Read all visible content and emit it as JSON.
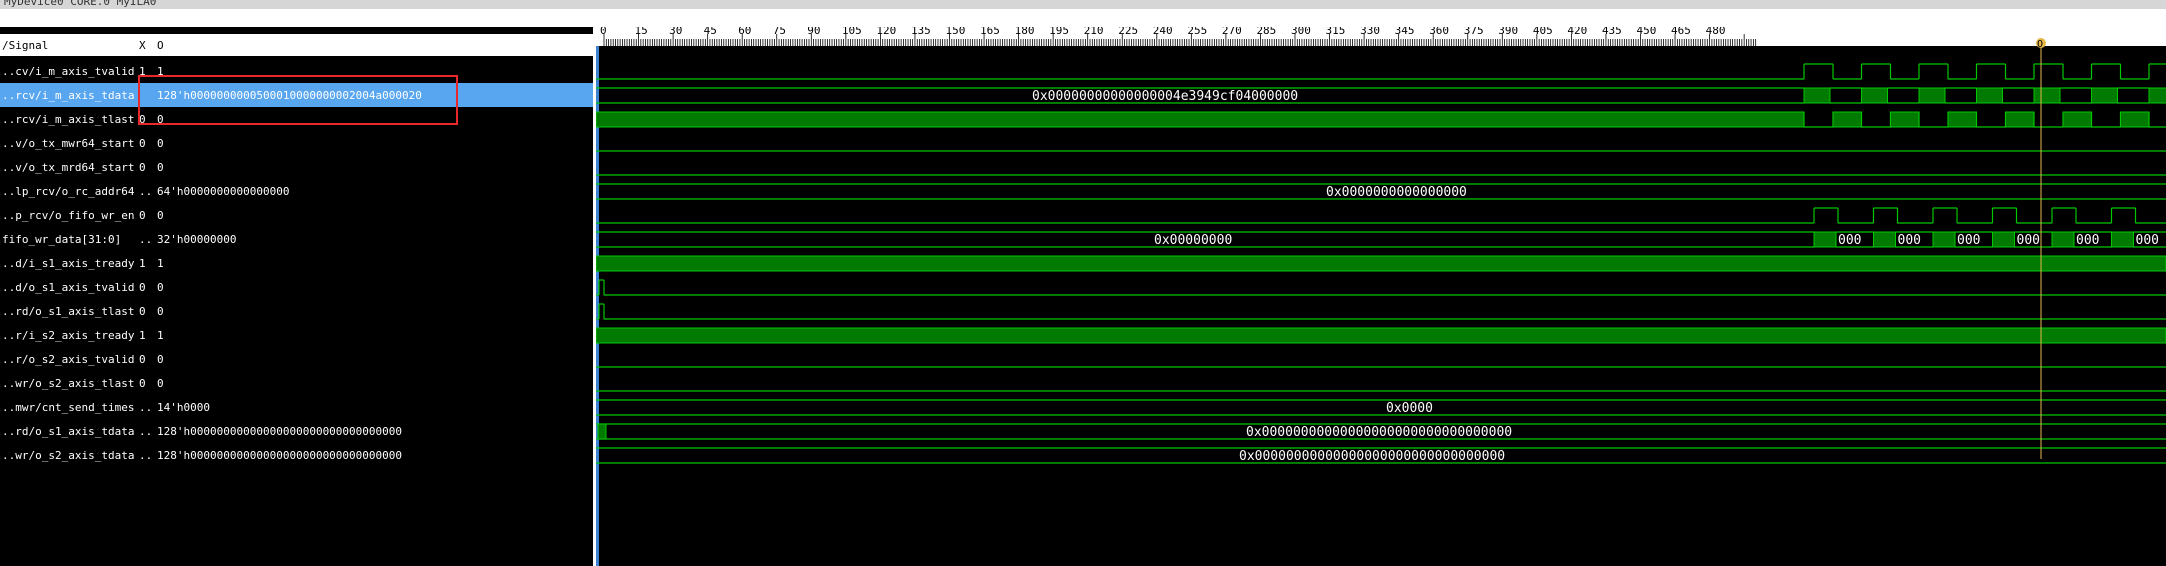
{
  "window": {
    "title": "MyDevice0 CORE.0 MyILA0"
  },
  "header": {
    "signal": "/Signal",
    "x": "X",
    "o": "O"
  },
  "signals": [
    {
      "name": "..cv/i_m_axis_tvalid",
      "x": "1",
      "value": "1"
    },
    {
      "name": "..rcv/i_m_axis_tdata",
      "x": "",
      "value": "128'h0000000000500010000000002004a000020"
    },
    {
      "name": "..rcv/i_m_axis_tlast",
      "x": "0",
      "value": "0"
    },
    {
      "name": "..v/o_tx_mwr64_start",
      "x": "0",
      "value": "0"
    },
    {
      "name": "..v/o_tx_mrd64_start",
      "x": "0",
      "value": "0"
    },
    {
      "name": "..lp_rcv/o_rc_addr64",
      "x": "..",
      "value": "64'h0000000000000000"
    },
    {
      "name": "..p_rcv/o_fifo_wr_en",
      "x": "0",
      "value": "0"
    },
    {
      "name": "fifo_wr_data[31:0]",
      "x": "..",
      "value": "32'h00000000"
    },
    {
      "name": "..d/i_s1_axis_tready",
      "x": "1",
      "value": "1"
    },
    {
      "name": "..d/o_s1_axis_tvalid",
      "x": "0",
      "value": "0"
    },
    {
      "name": "..rd/o_s1_axis_tlast",
      "x": "0",
      "value": "0"
    },
    {
      "name": "..r/i_s2_axis_tready",
      "x": "1",
      "value": "1"
    },
    {
      "name": "..r/o_s2_axis_tvalid",
      "x": "0",
      "value": "0"
    },
    {
      "name": "..wr/o_s2_axis_tlast",
      "x": "0",
      "value": "0"
    },
    {
      "name": "..mwr/cnt_send_times",
      "x": "..",
      "value": "14'h0000"
    },
    {
      "name": "..rd/o_s1_axis_tdata",
      "x": "..",
      "value": "128'h00000000000000000000000000000000"
    },
    {
      "name": "..wr/o_s2_axis_tdata",
      "x": "..",
      "value": "128'h00000000000000000000000000000000"
    }
  ],
  "ruler_ticks": [
    "0",
    "15",
    "30",
    "45",
    "60",
    "75",
    "90",
    "105",
    "120",
    "135",
    "150",
    "165",
    "180",
    "195",
    "210",
    "225",
    "240",
    "255",
    "270",
    "285",
    "300",
    "315",
    "330",
    "345",
    "360",
    "375",
    "390",
    "405",
    "420",
    "435",
    "450",
    "465",
    "480"
  ],
  "bus_values": {
    "tdata": "0x00000000000000004e3949cf04000000",
    "rc_addr64": "0x0000000000000000",
    "fifo_wr_data": "0x00000000",
    "fifo_trailing": "000",
    "cnt_send_times": "0x0000",
    "s1_tdata": "0x00000000000000000000000000000000",
    "s2_tdata": "0x00000000000000000000000000000000"
  },
  "cursor": {
    "marker": "O",
    "position": 453
  },
  "colors": {
    "wave": "#00c800",
    "wave_fill": "#007a00",
    "cursor": "#e6b84a",
    "selection": "#58a6ef",
    "highlight": "#e8282b"
  }
}
